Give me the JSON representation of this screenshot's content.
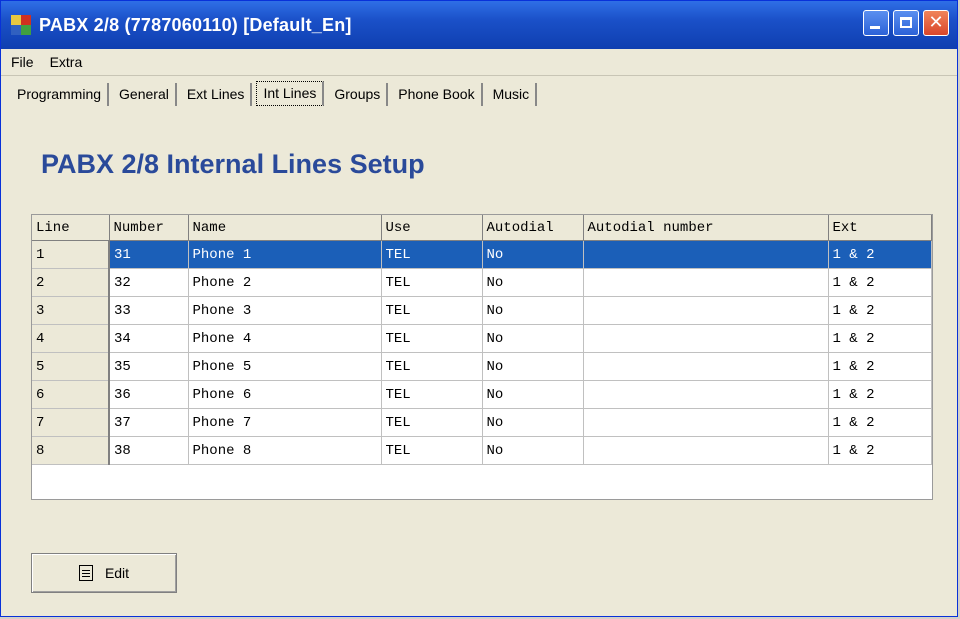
{
  "window": {
    "title": "PABX 2/8 (7787060110) [Default_En]",
    "icon": "app-icon"
  },
  "titlebar_buttons": [
    "minimize-icon",
    "maximize-icon",
    "close-icon"
  ],
  "menu": [
    {
      "label": "File"
    },
    {
      "label": "Extra"
    }
  ],
  "tabs": [
    {
      "label": "Programming"
    },
    {
      "label": "General"
    },
    {
      "label": "Ext Lines"
    },
    {
      "label": "Int Lines",
      "active": true
    },
    {
      "label": "Groups"
    },
    {
      "label": "Phone Book"
    },
    {
      "label": "Music"
    }
  ],
  "heading": "PABX 2/8 Internal Lines Setup",
  "table": {
    "columns": [
      "Line",
      "Number",
      "Name",
      "Use",
      "Autodial",
      "Autodial number",
      "Ext"
    ],
    "rows": [
      {
        "line": "1",
        "number": "31",
        "name": "Phone 1",
        "use": "TEL",
        "autodial": "No",
        "autodial_number": "",
        "ext": "1 & 2",
        "selected": true
      },
      {
        "line": "2",
        "number": "32",
        "name": "Phone 2",
        "use": "TEL",
        "autodial": "No",
        "autodial_number": "",
        "ext": "1 & 2"
      },
      {
        "line": "3",
        "number": "33",
        "name": "Phone 3",
        "use": "TEL",
        "autodial": "No",
        "autodial_number": "",
        "ext": "1 & 2"
      },
      {
        "line": "4",
        "number": "34",
        "name": "Phone 4",
        "use": "TEL",
        "autodial": "No",
        "autodial_number": "",
        "ext": "1 & 2"
      },
      {
        "line": "5",
        "number": "35",
        "name": "Phone 5",
        "use": "TEL",
        "autodial": "No",
        "autodial_number": "",
        "ext": "1 & 2"
      },
      {
        "line": "6",
        "number": "36",
        "name": "Phone 6",
        "use": "TEL",
        "autodial": "No",
        "autodial_number": "",
        "ext": "1 & 2"
      },
      {
        "line": "7",
        "number": "37",
        "name": "Phone 7",
        "use": "TEL",
        "autodial": "No",
        "autodial_number": "",
        "ext": "1 & 2"
      },
      {
        "line": "8",
        "number": "38",
        "name": "Phone 8",
        "use": "TEL",
        "autodial": "No",
        "autodial_number": "",
        "ext": "1 & 2"
      }
    ]
  },
  "edit_button": {
    "label": "Edit",
    "icon": "document-icon"
  },
  "colors": {
    "title_bar": "#1a50c8",
    "heading": "#2a4a9a",
    "selection": "#1b5fb8"
  }
}
